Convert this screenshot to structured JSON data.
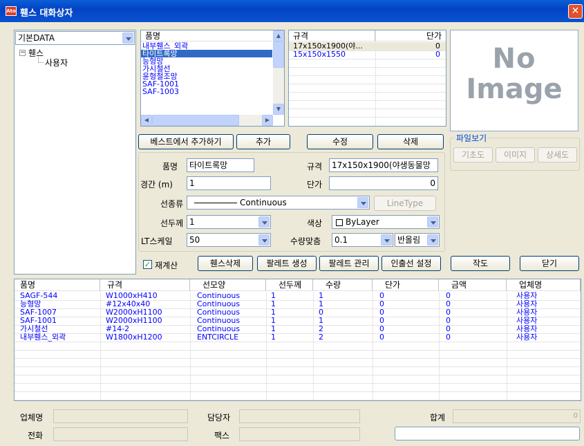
{
  "window": {
    "title": "휀스 대화상자",
    "icon_text": "Ato"
  },
  "tree": {
    "dropdown_value": "기본DATA",
    "root": "휀스",
    "child": "사용자"
  },
  "product_list": {
    "header": "품명",
    "items": [
      "내부휀스_외곽",
      "타이트록망",
      "능형망",
      "가시철선",
      "윤형철조망",
      "SAF-1001",
      "SAF-1003"
    ],
    "selected_index": 1
  },
  "spec_list": {
    "col_spec": "규격",
    "col_price": "단가",
    "rows": [
      {
        "spec": "17x150x1900(야...",
        "price": "0"
      },
      {
        "spec": "15x150x1550",
        "price": "0"
      }
    ]
  },
  "image_preview": {
    "line1": "No",
    "line2": "Image"
  },
  "file_view": {
    "title": "파일보기",
    "buttons": [
      "기초도",
      "이미지",
      "상세도"
    ]
  },
  "actions": {
    "add_from_best": "베스트에서 추가하기",
    "add": "추가",
    "edit": "수정",
    "delete": "삭제"
  },
  "form": {
    "name_label": "품명",
    "name_value": "타이트록망",
    "spec_label": "규격",
    "spec_value": "17x150x1900(야생동물망",
    "span_label": "경간 (m)",
    "span_value": "1",
    "price_label": "단가",
    "price_value": "0",
    "linetype_label": "선종류",
    "linetype_value": "Continuous",
    "linetype_button": "LineType",
    "lineweight_label": "선두께",
    "lineweight_value": "1",
    "color_label": "색상",
    "color_value": "ByLayer",
    "ltscale_label": "LT스케일",
    "ltscale_value": "50",
    "qtyfit_label": "수량맞춤",
    "qtyfit_value": "0.1",
    "round_value": "반올림"
  },
  "bottom_buttons": {
    "recalc": "재계산",
    "delete_fence": "휀스삭제",
    "palette_create": "팔레트 생성",
    "palette_manage": "팔레트 관리",
    "leader_settings": "인출선 설정",
    "draw": "작도",
    "close": "닫기"
  },
  "grid": {
    "headers": [
      "품명",
      "규격",
      "선모양",
      "선두께",
      "수량",
      "단가",
      "금액",
      "업체명"
    ],
    "rows": [
      [
        "SAGF-544",
        "W1000xH410",
        "Continuous",
        "1",
        "1",
        "0",
        "0",
        "사용자"
      ],
      [
        "능형망",
        "#12x40x40",
        "Continuous",
        "1",
        "1",
        "0",
        "0",
        "사용자"
      ],
      [
        "SAF-1007",
        "W2000xH1100",
        "Continuous",
        "1",
        "0",
        "0",
        "0",
        "사용자"
      ],
      [
        "SAF-1001",
        "W2000xH1100",
        "Continuous",
        "1",
        "1",
        "0",
        "0",
        "사용자"
      ],
      [
        "가시철선",
        "#14-2",
        "Continuous",
        "1",
        "2",
        "0",
        "0",
        "사용자"
      ],
      [
        "내부휀스_외곽",
        "W1800xH1200",
        "ENTCIRCLE",
        "1",
        "2",
        "0",
        "0",
        "사용자"
      ]
    ]
  },
  "footer": {
    "vendor_label": "업체명",
    "manager_label": "담당자",
    "total_label": "합계",
    "total_value": "0",
    "phone_label": "전화",
    "fax_label": "팩스"
  }
}
